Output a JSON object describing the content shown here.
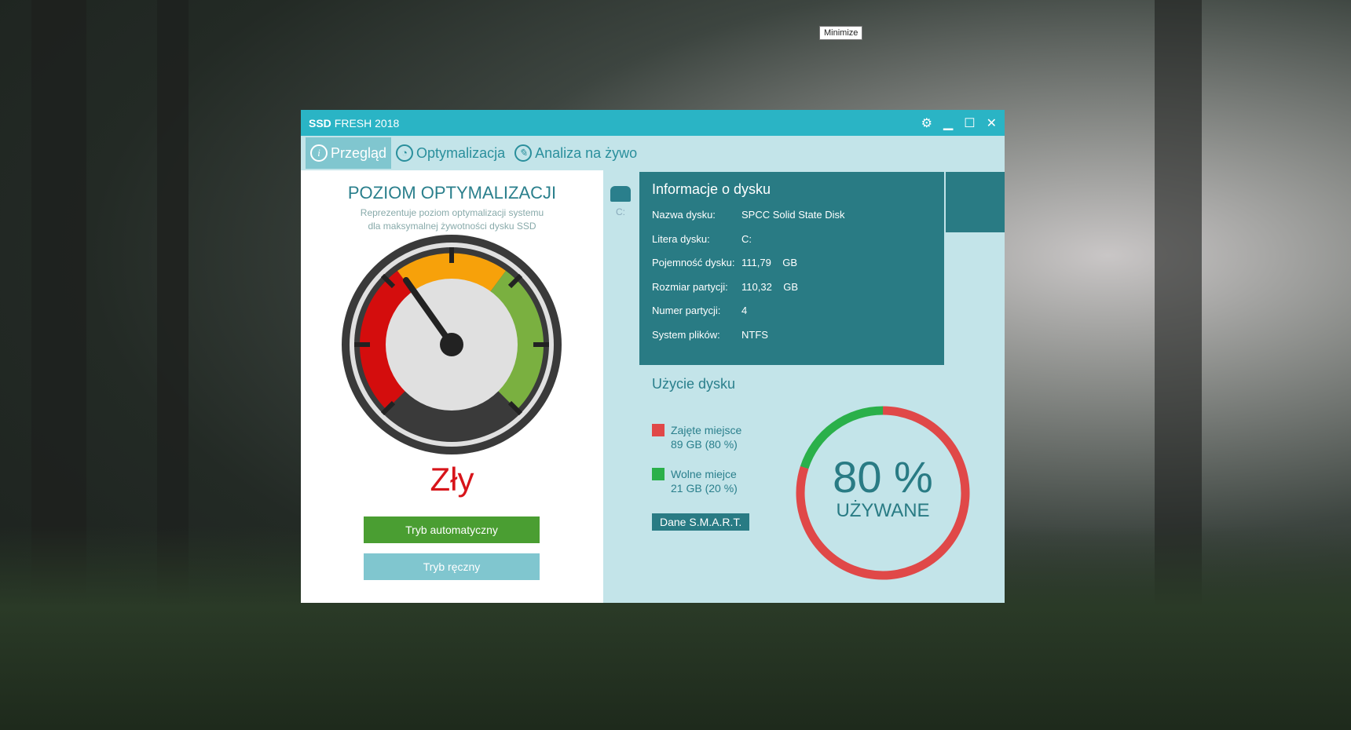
{
  "tooltip": "Minimize",
  "title": {
    "bold": "SSD",
    "rest": "FRESH 2018"
  },
  "tabs": [
    {
      "label": "Przegląd",
      "icon": "info-icon"
    },
    {
      "label": "Optymalizacja",
      "icon": "speedometer-icon"
    },
    {
      "label": "Analiza na żywo",
      "icon": "pencil-icon"
    }
  ],
  "optimization": {
    "title": "POZIOM OPTYMALIZACJI",
    "sub1": "Reprezentuje poziom optymalizacji systemu",
    "sub2": "dla maksymalnej żywotności dysku SSD",
    "status": "Zły",
    "auto_button": "Tryb automatyczny",
    "manual_button": "Tryb ręczny"
  },
  "drive_letter": "C:",
  "info": {
    "title": "Informacje o dysku",
    "rows": [
      {
        "k": "Nazwa dysku:",
        "v": "SPCC Solid State Disk"
      },
      {
        "k": "Litera dysku:",
        "v": "C:"
      },
      {
        "k": "Pojemność dysku:",
        "v": "111,79    GB"
      },
      {
        "k": "Rozmiar partycji:",
        "v": "110,32    GB"
      },
      {
        "k": "Numer partycji:",
        "v": "4"
      },
      {
        "k": "System plików:",
        "v": "NTFS"
      }
    ]
  },
  "usage": {
    "title": "Użycie dysku",
    "used_label": "Zajęte miejsce",
    "used_value": "89 GB (80 %)",
    "free_label": "Wolne miejce",
    "free_value": "21 GB (20 %)",
    "smart_button": "Dane S.M.A.R.T.",
    "percent_text": "80 %",
    "percent_label": "UŻYWANE",
    "used_fraction": 0.8,
    "used_color": "#e04848",
    "free_color": "#2ab04a"
  }
}
